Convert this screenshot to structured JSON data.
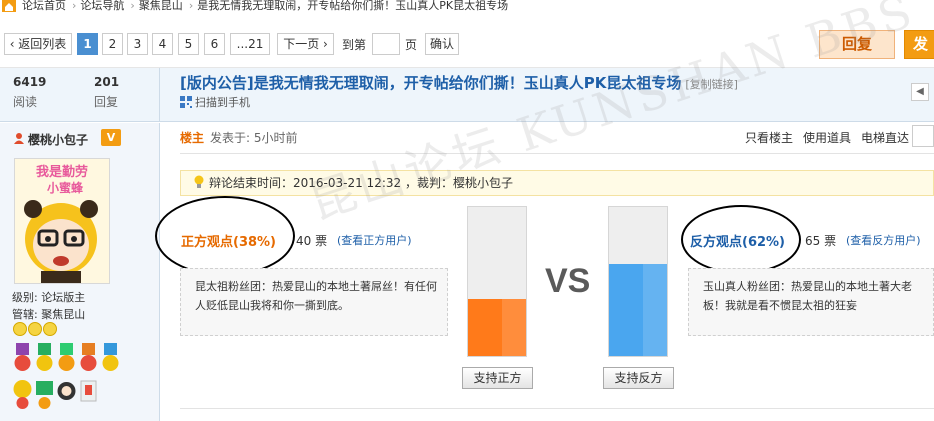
{
  "breadcrumb": {
    "items": [
      "论坛首页",
      "论坛导航",
      "聚焦昆山",
      "是我无情我无理取闹，开专帖给你们撕！玉山真人PK昆太祖专场"
    ],
    "separator": "›"
  },
  "pager": {
    "back_label": "‹ 返回列表",
    "pages": [
      "1",
      "2",
      "3",
      "4",
      "5",
      "6",
      "...21"
    ],
    "current": "1",
    "next_label": "下一页 ›",
    "jump_prefix": "到第",
    "jump_suffix": "页",
    "confirm_label": "确认",
    "reply_label": "回复",
    "post_label": "发"
  },
  "stats": {
    "views_value": "6419",
    "views_label": "阅读",
    "replies_value": "201",
    "replies_label": "回复"
  },
  "thread": {
    "title": "[版内公告]是我无情我无理取闹，开专帖给你们撕！玉山真人PK昆太祖专场",
    "copy_link": "[复制链接]",
    "scan_label": "扫描到手机"
  },
  "author": {
    "name": "樱桃小包子",
    "badge": "V",
    "avatar_text_1": "我是勤劳",
    "avatar_text_2": "小蜜蜂",
    "level_label": "级别:",
    "level_value": "论坛版主",
    "manage_label": "管辖:",
    "manage_value": "聚焦昆山"
  },
  "post": {
    "owner_label": "楼主",
    "posted_time": "发表于: 5小时前",
    "tools": [
      "只看楼主",
      "使用道具",
      "电梯直达"
    ]
  },
  "debate": {
    "info": "辩论结束时间：2016-03-21 12:32 ，裁判：樱桃小包子",
    "pro": {
      "label": "正方观点(38%)",
      "percent": 38,
      "votes": "40 票",
      "see_users": "(查看正方用户)",
      "view": "昆太祖粉丝团：热爱昆山的本地土著屌丝！有任何人贬低昆山我将和你一撕到底。",
      "support_label": "支持正方",
      "color": "#ff7a1a"
    },
    "con": {
      "label": "反方观点(62%)",
      "percent": 62,
      "votes": "65 票",
      "see_users": "(查看反方用户)",
      "view": "玉山真人粉丝团：热爱昆山的本地土著大老板！我就是看不惯昆太祖的狂妄",
      "support_label": "支持反方",
      "color": "#4aa6ef"
    },
    "vs_label": "VS"
  },
  "watermark": "昆山论坛 KUNSHAN BBS"
}
